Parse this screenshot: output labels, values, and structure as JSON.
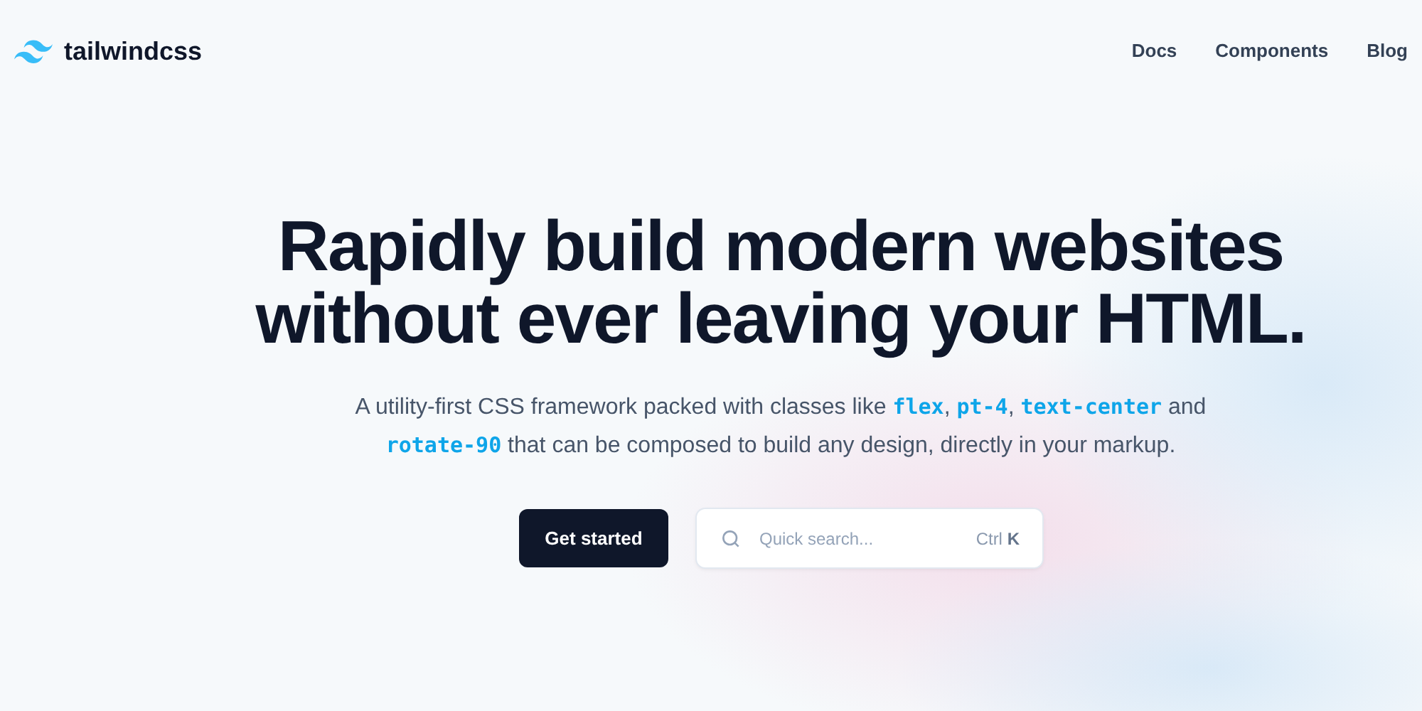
{
  "brand": {
    "name": "tailwindcss"
  },
  "nav": [
    {
      "label": "Docs"
    },
    {
      "label": "Components"
    },
    {
      "label": "Blog"
    }
  ],
  "headline": [
    "Rapidly build modern websites",
    "without ever leaving your HTML."
  ],
  "lead": [
    [
      {
        "kind": "text",
        "text": "A utility-first CSS framework packed with classes like "
      },
      {
        "kind": "code",
        "text": "flex"
      },
      {
        "kind": "text",
        "text": ", "
      },
      {
        "kind": "code",
        "text": "pt-4"
      },
      {
        "kind": "text",
        "text": ", "
      },
      {
        "kind": "code",
        "text": "text-center"
      },
      {
        "kind": "text",
        "text": " and"
      }
    ],
    [
      {
        "kind": "code",
        "text": "rotate-90"
      },
      {
        "kind": "text",
        "text": " that can be composed to build any design, directly in your markup."
      }
    ]
  ],
  "cta": {
    "label": "Get started"
  },
  "search": {
    "placeholder": "Quick search...",
    "shortcut_modifier": "Ctrl",
    "shortcut_key": "K"
  }
}
